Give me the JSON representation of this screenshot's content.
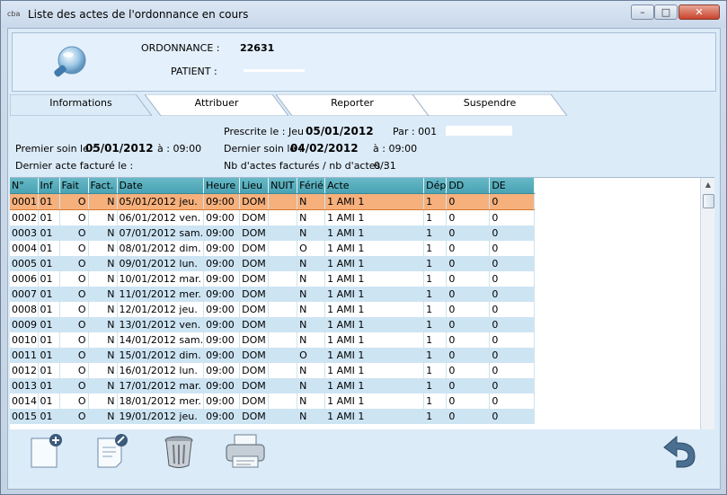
{
  "window": {
    "app_icon_text": "cba",
    "title": "Liste des actes de l'ordonnance en cours",
    "minimize": "–",
    "maximize": "□",
    "close": "✕"
  },
  "header": {
    "ordonnance_label": "ORDONNANCE :",
    "ordonnance_value": "22631",
    "patient_label": "PATIENT :",
    "patient_value": ""
  },
  "tabs": [
    {
      "label": "Informations",
      "active": true
    },
    {
      "label": "Attribuer",
      "active": false
    },
    {
      "label": "Reporter",
      "active": false
    },
    {
      "label": "Suspendre",
      "active": false
    }
  ],
  "info": {
    "prescrite_label": "Prescrite le : Jeu",
    "prescrite_date": "05/01/2012",
    "par_label": "Par : 001",
    "premier_label": "Premier soin le :",
    "premier_date": "05/01/2012",
    "premier_time": "à : 09:00",
    "dernier_label": "Dernier soin le :",
    "dernier_date": "04/02/2012",
    "dernier_time": "à : 09:00",
    "dernier_acte_label": "Dernier acte facturé le :",
    "nb_actes_label": "Nb d'actes facturés / nb d'actes :",
    "nb_actes_value": "0/31"
  },
  "grid": {
    "columns": [
      "N°",
      "Inf",
      "Fait",
      "Fact.",
      "Date",
      "Heure",
      "Lieu",
      "NUIT",
      "Férié",
      "Acte",
      "Dép",
      "DD",
      "DE"
    ],
    "rows": [
      [
        "0001",
        "01",
        "O",
        "N",
        "05/01/2012 jeu.",
        "09:00",
        "DOM",
        "",
        "N",
        "1  AMI   1",
        "1",
        "0",
        "0"
      ],
      [
        "0002",
        "01",
        "O",
        "N",
        "06/01/2012 ven.",
        "09:00",
        "DOM",
        "",
        "N",
        "1  AMI   1",
        "1",
        "0",
        "0"
      ],
      [
        "0003",
        "01",
        "O",
        "N",
        "07/01/2012 sam.",
        "09:00",
        "DOM",
        "",
        "N",
        "1  AMI   1",
        "1",
        "0",
        "0"
      ],
      [
        "0004",
        "01",
        "O",
        "N",
        "08/01/2012 dim.",
        "09:00",
        "DOM",
        "",
        "O",
        "1  AMI   1",
        "1",
        "0",
        "0"
      ],
      [
        "0005",
        "01",
        "O",
        "N",
        "09/01/2012 lun.",
        "09:00",
        "DOM",
        "",
        "N",
        "1  AMI   1",
        "1",
        "0",
        "0"
      ],
      [
        "0006",
        "01",
        "O",
        "N",
        "10/01/2012 mar.",
        "09:00",
        "DOM",
        "",
        "N",
        "1  AMI   1",
        "1",
        "0",
        "0"
      ],
      [
        "0007",
        "01",
        "O",
        "N",
        "11/01/2012 mer.",
        "09:00",
        "DOM",
        "",
        "N",
        "1  AMI   1",
        "1",
        "0",
        "0"
      ],
      [
        "0008",
        "01",
        "O",
        "N",
        "12/01/2012 jeu.",
        "09:00",
        "DOM",
        "",
        "N",
        "1  AMI   1",
        "1",
        "0",
        "0"
      ],
      [
        "0009",
        "01",
        "O",
        "N",
        "13/01/2012 ven.",
        "09:00",
        "DOM",
        "",
        "N",
        "1  AMI   1",
        "1",
        "0",
        "0"
      ],
      [
        "0010",
        "01",
        "O",
        "N",
        "14/01/2012 sam.",
        "09:00",
        "DOM",
        "",
        "N",
        "1  AMI   1",
        "1",
        "0",
        "0"
      ],
      [
        "0011",
        "01",
        "O",
        "N",
        "15/01/2012 dim.",
        "09:00",
        "DOM",
        "",
        "O",
        "1  AMI   1",
        "1",
        "0",
        "0"
      ],
      [
        "0012",
        "01",
        "O",
        "N",
        "16/01/2012 lun.",
        "09:00",
        "DOM",
        "",
        "N",
        "1  AMI   1",
        "1",
        "0",
        "0"
      ],
      [
        "0013",
        "01",
        "O",
        "N",
        "17/01/2012 mar.",
        "09:00",
        "DOM",
        "",
        "N",
        "1  AMI   1",
        "1",
        "0",
        "0"
      ],
      [
        "0014",
        "01",
        "O",
        "N",
        "18/01/2012 mer.",
        "09:00",
        "DOM",
        "",
        "N",
        "1  AMI   1",
        "1",
        "0",
        "0"
      ],
      [
        "0015",
        "01",
        "O",
        "N",
        "19/01/2012 jeu.",
        "09:00",
        "DOM",
        "",
        "N",
        "1  AMI   1",
        "1",
        "0",
        "0"
      ]
    ],
    "selected_row": 0
  },
  "toolbar": [
    {
      "icon": "add-document-icon"
    },
    {
      "icon": "edit-document-icon"
    },
    {
      "icon": "trash-icon"
    },
    {
      "icon": "printer-icon"
    },
    {
      "icon": "undo-icon"
    }
  ],
  "colors": {
    "header_row": "#4aa3b3",
    "selected_row": "#f6b07c",
    "alt_row": "#cde4f3",
    "background": "#dcebf8"
  }
}
